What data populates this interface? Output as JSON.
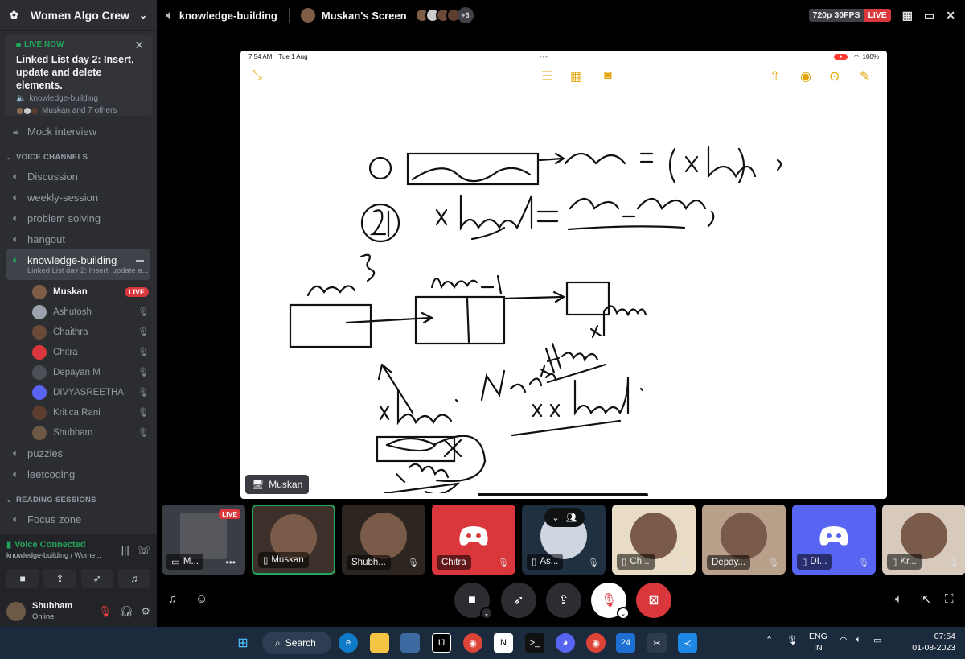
{
  "server": {
    "name": "Women Algo Crew"
  },
  "live_card": {
    "status": "LIVE NOW",
    "title": "Linked List day 2: Insert, update and delete elements.",
    "channel": "knowledge-building",
    "people": "Muskan and 7 others"
  },
  "channels": {
    "mock": "Mock interview",
    "voice_category": "VOICE CHANNELS",
    "discussion": "Discussion",
    "weekly": "weekly-session",
    "problem": "problem solving",
    "hangout": "hangout",
    "active": "knowledge-building",
    "active_sub": "Linked List day 2: Insert, update a...",
    "puzzles": "puzzles",
    "leetcoding": "leetcoding",
    "reading_category": "READING SESSIONS",
    "focus": "Focus zone"
  },
  "members": [
    {
      "name": "Muskan",
      "live": "LIVE",
      "color": "#7e5c45"
    },
    {
      "name": "Ashutosh",
      "color": "#9aa3ad"
    },
    {
      "name": "Chaithra",
      "color": "#6b4a3a"
    },
    {
      "name": "Chitra",
      "color": "#da373c"
    },
    {
      "name": "Depayan M",
      "color": "#4a4f58"
    },
    {
      "name": "DIVYASREETHA",
      "color": "#5865f2"
    },
    {
      "name": "Kritica Rani",
      "color": "#5c3d30"
    },
    {
      "name": "Shubham",
      "color": "#6e5846"
    }
  ],
  "voice_panel": {
    "status": "Voice Connected",
    "where": "knowledge-building / Wome..."
  },
  "user": {
    "name": "Shubham",
    "status": "Online"
  },
  "topbar": {
    "channel": "knowledge-building",
    "screen": "Muskan's Screen",
    "more": "+3",
    "quality": "720p 30FPS",
    "live": "LIVE"
  },
  "stream": {
    "time": "7:54 AM",
    "date": "Tue 1 Aug",
    "battery": "100%",
    "owner": "Muskan"
  },
  "tiles": [
    {
      "label": "M...",
      "kind": "screen",
      "live": "LIVE"
    },
    {
      "label": "Muskan",
      "kind": "phone"
    },
    {
      "label": "Shubh...",
      "kind": "face"
    },
    {
      "label": "Chitra",
      "kind": "discord-red"
    },
    {
      "label": "As...",
      "kind": "phone"
    },
    {
      "label": "Ch...",
      "kind": "phone"
    },
    {
      "label": "Depay...",
      "kind": "face"
    },
    {
      "label": "DI...",
      "kind": "phone"
    },
    {
      "label": "Kr...",
      "kind": "phone"
    }
  ],
  "taskbar": {
    "search": "Search",
    "lang1": "ENG",
    "lang2": "IN",
    "time": "07:54",
    "date": "01-08-2023",
    "badge": "24"
  },
  "colors": {
    "accent_green": "#23a55a",
    "live_red": "#da373c",
    "blurple": "#5865f2"
  }
}
